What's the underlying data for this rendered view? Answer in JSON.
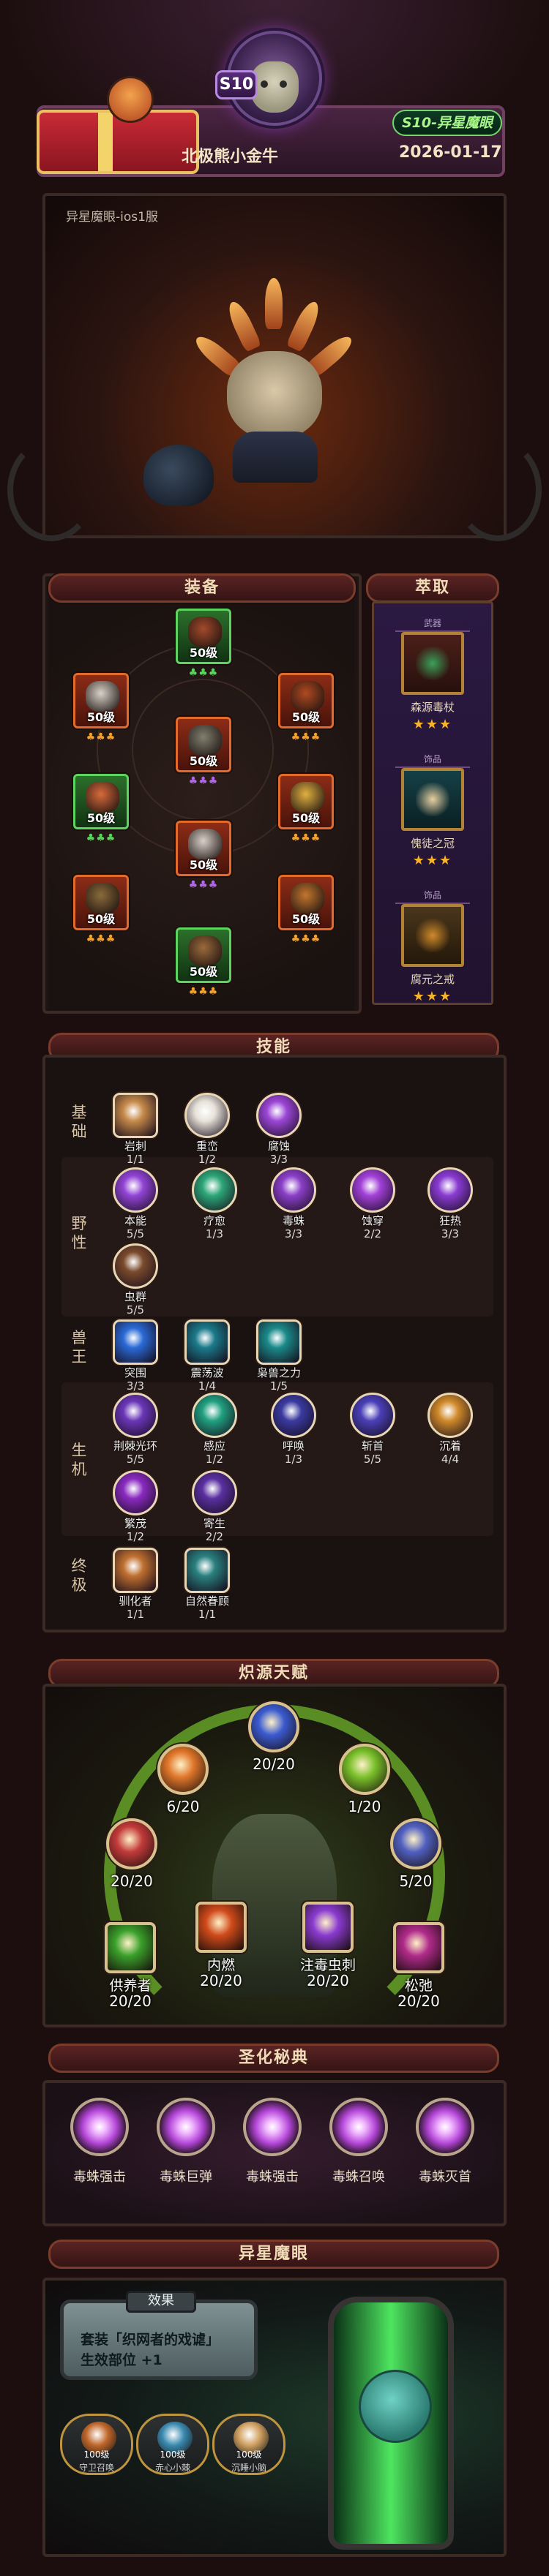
{
  "header": {
    "season_badge": "S10",
    "player_name": "北极熊小金牛",
    "date": "2026-01-17",
    "season_pill": "S10-异星魔眼"
  },
  "character": {
    "server": "异星魔眼-ios1服"
  },
  "sections": {
    "equipment": "装备",
    "extract": "萃取",
    "skills": "技能",
    "talent": "炽源天赋",
    "sanctified": "圣化秘典",
    "alien_eye": "异星魔眼"
  },
  "equipment": [
    {
      "level": "50级",
      "stars": "♣♣♣",
      "star_color": "#58d65a",
      "rarity": "green",
      "icon_color": "#a34a2a"
    },
    {
      "level": "50级",
      "stars": "♣♣♣",
      "star_color": "#f5a12a",
      "rarity": "red",
      "icon_color": "#d8d2c8"
    },
    {
      "level": "50级",
      "stars": "♣♣♣",
      "star_color": "#f5a12a",
      "rarity": "red",
      "icon_color": "#b04a20"
    },
    {
      "level": "50级",
      "stars": "♣♣♣",
      "star_color": "#b068e8",
      "rarity": "red",
      "icon_color": "#7f7f6f"
    },
    {
      "level": "50级",
      "stars": "♣♣♣",
      "star_color": "#58d65a",
      "rarity": "green",
      "icon_color": "#d86a3a"
    },
    {
      "level": "50级",
      "stars": "♣♣♣",
      "star_color": "#f5a12a",
      "rarity": "red",
      "icon_color": "#e0b040"
    },
    {
      "level": "50级",
      "stars": "♣♣♣",
      "star_color": "#b068e8",
      "rarity": "red",
      "icon_color": "#d8d0c8"
    },
    {
      "level": "50级",
      "stars": "♣♣♣",
      "star_color": "#f5a12a",
      "rarity": "red",
      "icon_color": "#8a6b3a"
    },
    {
      "level": "50级",
      "stars": "♣♣♣",
      "star_color": "#f5a12a",
      "rarity": "red",
      "icon_color": "#c2762e"
    },
    {
      "level": "50级",
      "stars": "♣♣♣",
      "star_color": "#f5a12a",
      "rarity": "green",
      "icon_color": "#9a6a3a"
    }
  ],
  "extract": [
    {
      "tag": "武器",
      "name": "森源毒杖",
      "stars": "★★★"
    },
    {
      "tag": "饰品",
      "name": "傀徒之冠",
      "stars": "★★★"
    },
    {
      "tag": "饰品",
      "name": "腐元之戒",
      "stars": "★★★"
    }
  ],
  "skills": {
    "categories": {
      "basic": "基础",
      "wild": "野性",
      "beast": "兽王",
      "vitality": "生机",
      "ultimate": "终极"
    },
    "basic": [
      {
        "name": "岩刺",
        "level": "1/1",
        "color": "#c78a4a"
      },
      {
        "name": "重峦",
        "level": "1/2",
        "color": "#e7e2da"
      },
      {
        "name": "腐蚀",
        "level": "3/3",
        "color": "#9b46d6"
      }
    ],
    "wild": [
      {
        "name": "本能",
        "level": "5/5",
        "color": "#9244d6"
      },
      {
        "name": "疗愈",
        "level": "1/3",
        "color": "#2ca678"
      },
      {
        "name": "毒蛛",
        "level": "3/3",
        "color": "#8b3fc8"
      },
      {
        "name": "蚀穿",
        "level": "2/2",
        "color": "#a240d8"
      },
      {
        "name": "狂热",
        "level": "3/3",
        "color": "#8a3bd2"
      },
      {
        "name": "虫群",
        "level": "5/5",
        "color": "#7a4a2c"
      }
    ],
    "beast": [
      {
        "name": "突围",
        "level": "3/3",
        "color": "#2a6ad6"
      },
      {
        "name": "震荡波",
        "level": "1/4",
        "color": "#1a7a8a"
      },
      {
        "name": "枭兽之力",
        "level": "1/5",
        "color": "#1a8a8a"
      }
    ],
    "vitality": [
      {
        "name": "荆棘光环",
        "level": "5/5",
        "color": "#6a36b8"
      },
      {
        "name": "感应",
        "level": "1/2",
        "color": "#20a080"
      },
      {
        "name": "呼唤",
        "level": "1/3",
        "color": "#3a3aa0"
      },
      {
        "name": "斩首",
        "level": "5/5",
        "color": "#4a40b8"
      },
      {
        "name": "沉着",
        "level": "4/4",
        "color": "#d08a2a"
      },
      {
        "name": "繁茂",
        "level": "1/2",
        "color": "#8a2ac0"
      },
      {
        "name": "寄生",
        "level": "2/2",
        "color": "#5a30a0"
      }
    ],
    "ultimate": [
      {
        "name": "驯化者",
        "level": "1/1",
        "color": "#c07030"
      },
      {
        "name": "自然眷顾",
        "level": "1/1",
        "color": "#2a8080"
      }
    ]
  },
  "talent": [
    {
      "level": "6/20",
      "color": "#e0762a"
    },
    {
      "level": "20/20",
      "color": "#3a5ad0"
    },
    {
      "level": "1/20",
      "color": "#7ac02a"
    },
    {
      "level": "20/20",
      "color": "#c23a3a"
    },
    {
      "level": "5/20",
      "color": "#5060c0"
    },
    {
      "name": "供养者",
      "level": "20/20",
      "color": "#3aa02a"
    },
    {
      "name": "内燃",
      "level": "20/20",
      "color": "#d04a1a"
    },
    {
      "name": "注毒虫刺",
      "level": "20/20",
      "color": "#8a3ad0"
    },
    {
      "name": "松弛",
      "level": "20/20",
      "color": "#b02a8a"
    }
  ],
  "sanctified": [
    {
      "name": "毒蛛强击"
    },
    {
      "name": "毒蛛巨弹"
    },
    {
      "name": "毒蛛强击"
    },
    {
      "name": "毒蛛召唤"
    },
    {
      "name": "毒蛛灭首"
    }
  ],
  "alien_eye": {
    "effect_title": "效果",
    "effect_line1": "套装「织网者的戏谑」",
    "effect_line2": "生效部位 +1",
    "resources": [
      {
        "count": "100级",
        "name": "守卫召唤",
        "color": "#c0662a"
      },
      {
        "count": "100级",
        "name": "赤心小棘",
        "color": "#3a8ab0"
      },
      {
        "count": "100级",
        "name": "沉睡小脑",
        "color": "#d0a060"
      }
    ]
  },
  "colors": {
    "accent_green": "#72d86a",
    "panel_border": "#3c2b25",
    "banner": "#5a2323",
    "extract_bg": "#2b1942"
  }
}
